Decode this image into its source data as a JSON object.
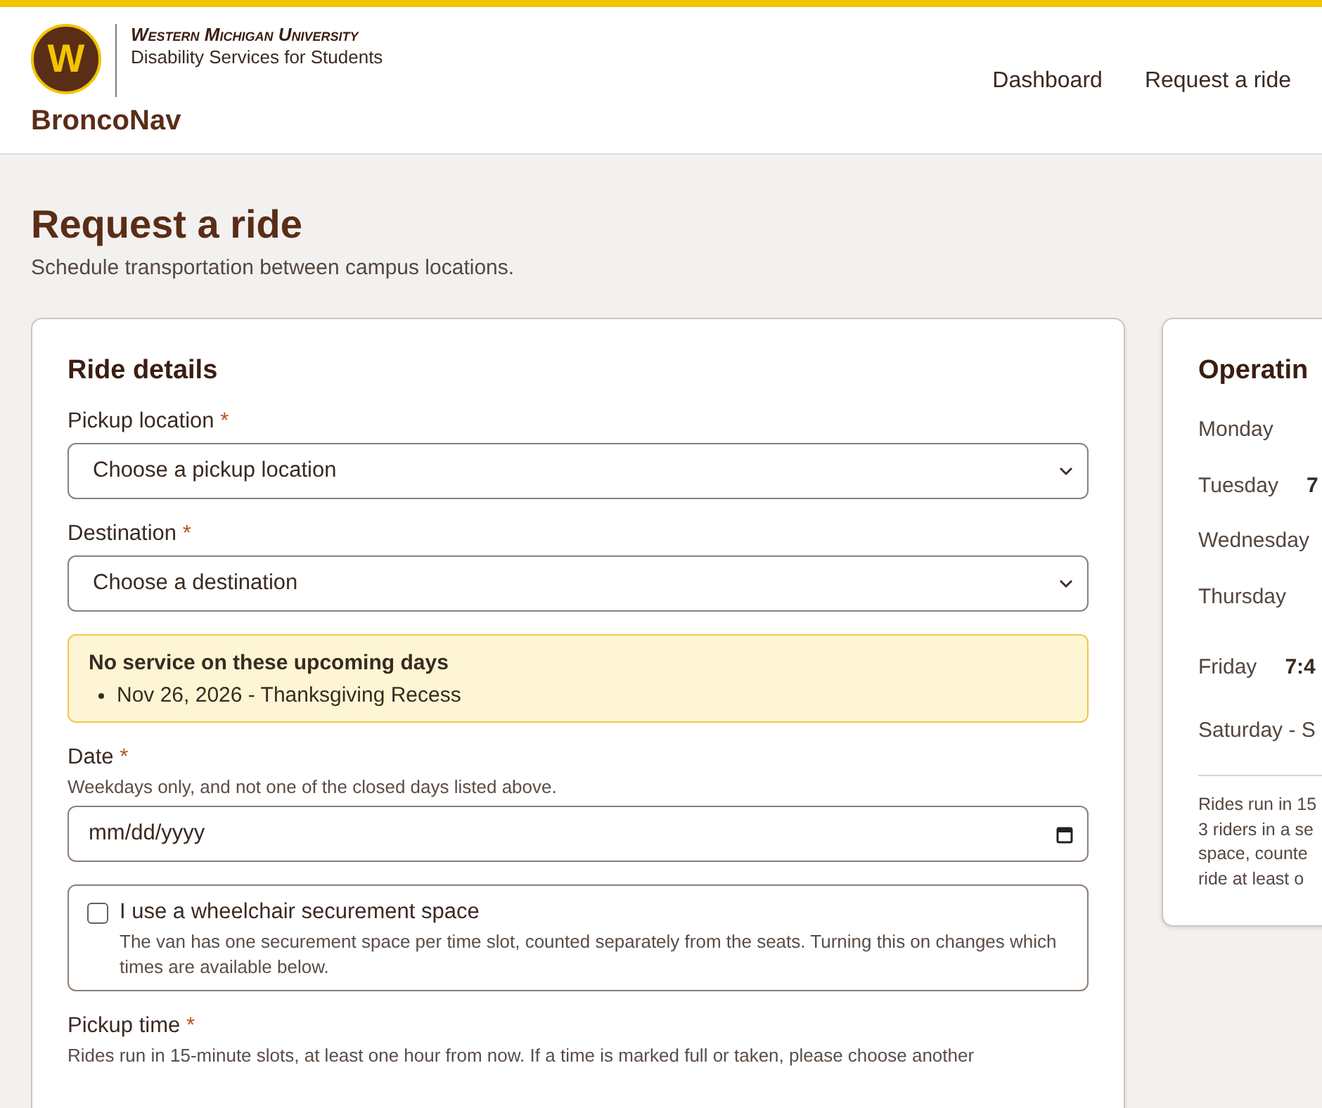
{
  "header": {
    "logo_letter": "W",
    "university": "Western Michigan University",
    "department": "Disability Services for Students",
    "app_name": "BroncoNav",
    "nav": [
      {
        "label": "Dashboard"
      },
      {
        "label": "Request a ride"
      }
    ]
  },
  "page": {
    "title": "Request a ride",
    "subtitle": "Schedule transportation between campus locations."
  },
  "form": {
    "title": "Ride details",
    "fields": [
      {
        "kind": "select",
        "label": "Pickup location",
        "required": "*",
        "placeholder": "Choose a pickup location"
      },
      {
        "kind": "select",
        "label": "Destination",
        "required": "*",
        "placeholder": "Choose a destination"
      },
      {
        "kind": "notice",
        "title": "No service on these upcoming days",
        "items": [
          "Nov 26, 2026 - Thanksgiving Recess"
        ]
      },
      {
        "kind": "date",
        "label": "Date",
        "required": "*",
        "hint": "Weekdays only, and not one of the closed days listed above.",
        "placeholder": "mm/dd/yyyy"
      },
      {
        "kind": "checkbox",
        "label": "I use a wheelchair securement space",
        "checked": false,
        "hint": "The van has one securement space per time slot, counted separately from the seats. Turning this on changes which times are available below."
      },
      {
        "kind": "heading",
        "label": "Pickup time",
        "required": "*",
        "hint": "Rides run in 15-minute slots, at least one hour from now. If a time is marked full or taken, please choose another"
      }
    ]
  },
  "hours": {
    "title": "Operatin",
    "rows": [
      {
        "day": "Monday",
        "time": ""
      },
      {
        "day": "Tuesday",
        "time": "7"
      },
      {
        "day": "Wednesday",
        "time": ""
      },
      {
        "day": "Thursday",
        "time": ""
      },
      {
        "day": "Friday",
        "time": "7:4"
      },
      {
        "day": "Saturday - S",
        "time": ""
      }
    ],
    "note": [
      "Rides run in 15",
      "3 riders in a se",
      "space, counte",
      "ride at least o"
    ]
  }
}
